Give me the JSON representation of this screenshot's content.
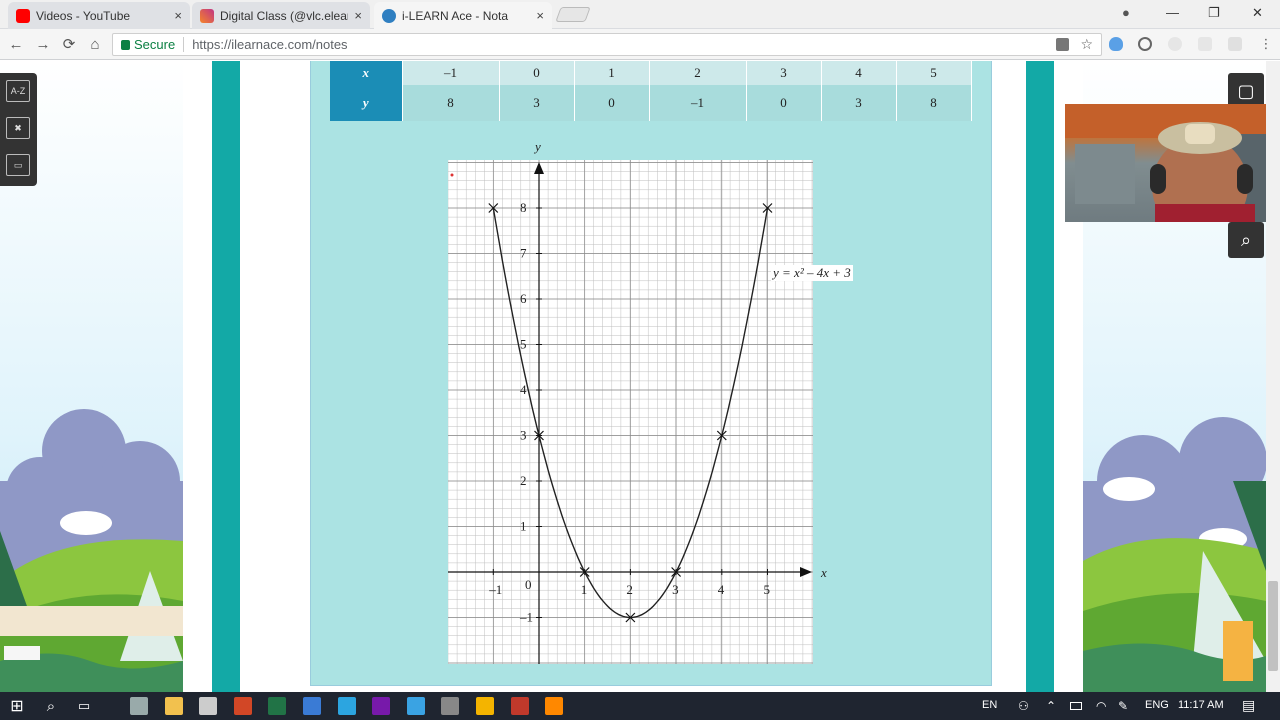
{
  "browser": {
    "tabs": [
      {
        "label": "Videos - YouTube",
        "icon": "youtube-icon",
        "color": "#ff0000"
      },
      {
        "label": "Digital Class (@vlc.elearn",
        "icon": "instagram-icon",
        "color": "#c13584"
      },
      {
        "label": "i-LEARN Ace - Nota",
        "icon": "ilearn-icon",
        "color": "#2f7fc1"
      }
    ],
    "close_glyph": "×",
    "window_controls": {
      "profile": "●",
      "minimize": "—",
      "maximize": "❐",
      "close": "✕"
    },
    "nav": {
      "back": "←",
      "forward": "→",
      "reload": "⟳",
      "home": "⌂"
    },
    "secure_label": "Secure",
    "url": "https://ilearnace.com/notes",
    "star": "☆"
  },
  "left_tools": [
    {
      "label": "A-Z",
      "icon": "dictionary-icon"
    },
    {
      "label": "✖",
      "icon": "formula-icon"
    },
    {
      "label": "▭",
      "icon": "whiteboard-icon"
    }
  ],
  "right_tools": {
    "notes": "▢",
    "zoom": "⌕"
  },
  "worksheet": {
    "colors": {
      "teal": "#13a9a6",
      "panel": "#abe3e3",
      "header": "#1b8db6"
    },
    "table": {
      "x_label": "x",
      "y_label": "y",
      "x_values": [
        "–1",
        "0",
        "1",
        "2",
        "3",
        "4",
        "5"
      ],
      "y_values": [
        "8",
        "3",
        "0",
        "–1",
        "0",
        "3",
        "8"
      ]
    },
    "graph": {
      "axis_x_label": "x",
      "axis_y_label": "y",
      "origin_label": "0",
      "equation": "y = x² – 4x + 3"
    }
  },
  "chart_data": {
    "type": "line",
    "title": "",
    "xlabel": "x",
    "ylabel": "y",
    "xlim": [
      -2,
      5.8
    ],
    "ylim": [
      -2,
      9
    ],
    "x_ticks": [
      "–1",
      "1",
      "2",
      "3",
      "4",
      "5"
    ],
    "y_ticks": [
      "–1",
      "1",
      "2",
      "3",
      "4",
      "5",
      "6",
      "7",
      "8"
    ],
    "grid": true,
    "series": [
      {
        "name": "y = x² – 4x + 3",
        "x": [
          -1,
          0,
          1,
          2,
          3,
          4,
          5
        ],
        "y": [
          8,
          3,
          0,
          -1,
          0,
          3,
          8
        ]
      }
    ],
    "markers": {
      "x": [
        -1,
        0,
        1,
        2,
        3,
        4,
        5
      ],
      "y": [
        8,
        3,
        0,
        -1,
        0,
        3,
        8
      ]
    }
  },
  "taskbar": {
    "start": "⊞",
    "search": "⌕",
    "task_view": "▭",
    "apps": [
      {
        "icon": "cortana-icon",
        "color": "#9aa"
      },
      {
        "icon": "file-explorer-icon",
        "color": "#f2c14e"
      },
      {
        "icon": "app-icon-1",
        "color": "#ccc"
      },
      {
        "icon": "powerpoint-icon",
        "color": "#d24726"
      },
      {
        "icon": "excel-icon",
        "color": "#217346"
      },
      {
        "icon": "browser-blue-icon",
        "color": "#3a7bd5"
      },
      {
        "icon": "telegram-icon",
        "color": "#2ca5e0"
      },
      {
        "icon": "onenote-icon",
        "color": "#7719aa"
      },
      {
        "icon": "app-icon-2",
        "color": "#3aa3e3"
      },
      {
        "icon": "app-icon-3",
        "color": "#888"
      },
      {
        "icon": "chrome-icon",
        "color": "#f4b400"
      },
      {
        "icon": "app-icon-4",
        "color": "#c0392b"
      },
      {
        "icon": "vlc-icon",
        "color": "#ff8800"
      }
    ],
    "lang": "EN",
    "ime": "ENG",
    "time": "11:17 AM",
    "notifications": "▤"
  }
}
